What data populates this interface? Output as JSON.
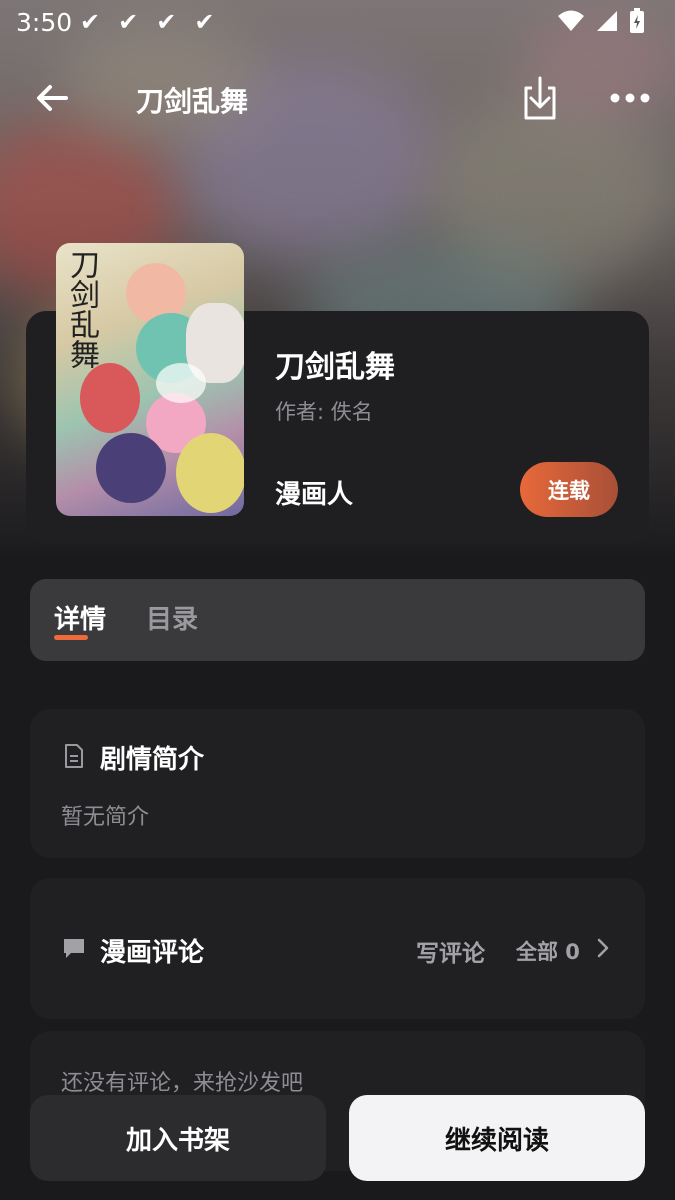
{
  "status_bar": {
    "time": "3:50",
    "notification_checks": [
      "✔",
      "✔",
      "✔",
      "✔"
    ]
  },
  "nav": {
    "title": "刀剑乱舞"
  },
  "manga": {
    "cover_title": "刀剑乱舞",
    "title": "刀剑乱舞",
    "author": "作者: 佚名",
    "source": "漫画人",
    "status": "连载"
  },
  "tabs": {
    "details": "详情",
    "catalog": "目录"
  },
  "synopsis": {
    "heading": "剧情简介",
    "text": "暂无简介"
  },
  "comments": {
    "heading": "漫画评论",
    "write": "写评论",
    "all": "全部 0",
    "empty": "还没有评论，来抢沙发吧"
  },
  "actions": {
    "add_to_shelf": "加入书架",
    "continue_reading": "继续阅读"
  },
  "colors": {
    "accent": "#ef6a3a",
    "background": "#1a1a1c"
  }
}
